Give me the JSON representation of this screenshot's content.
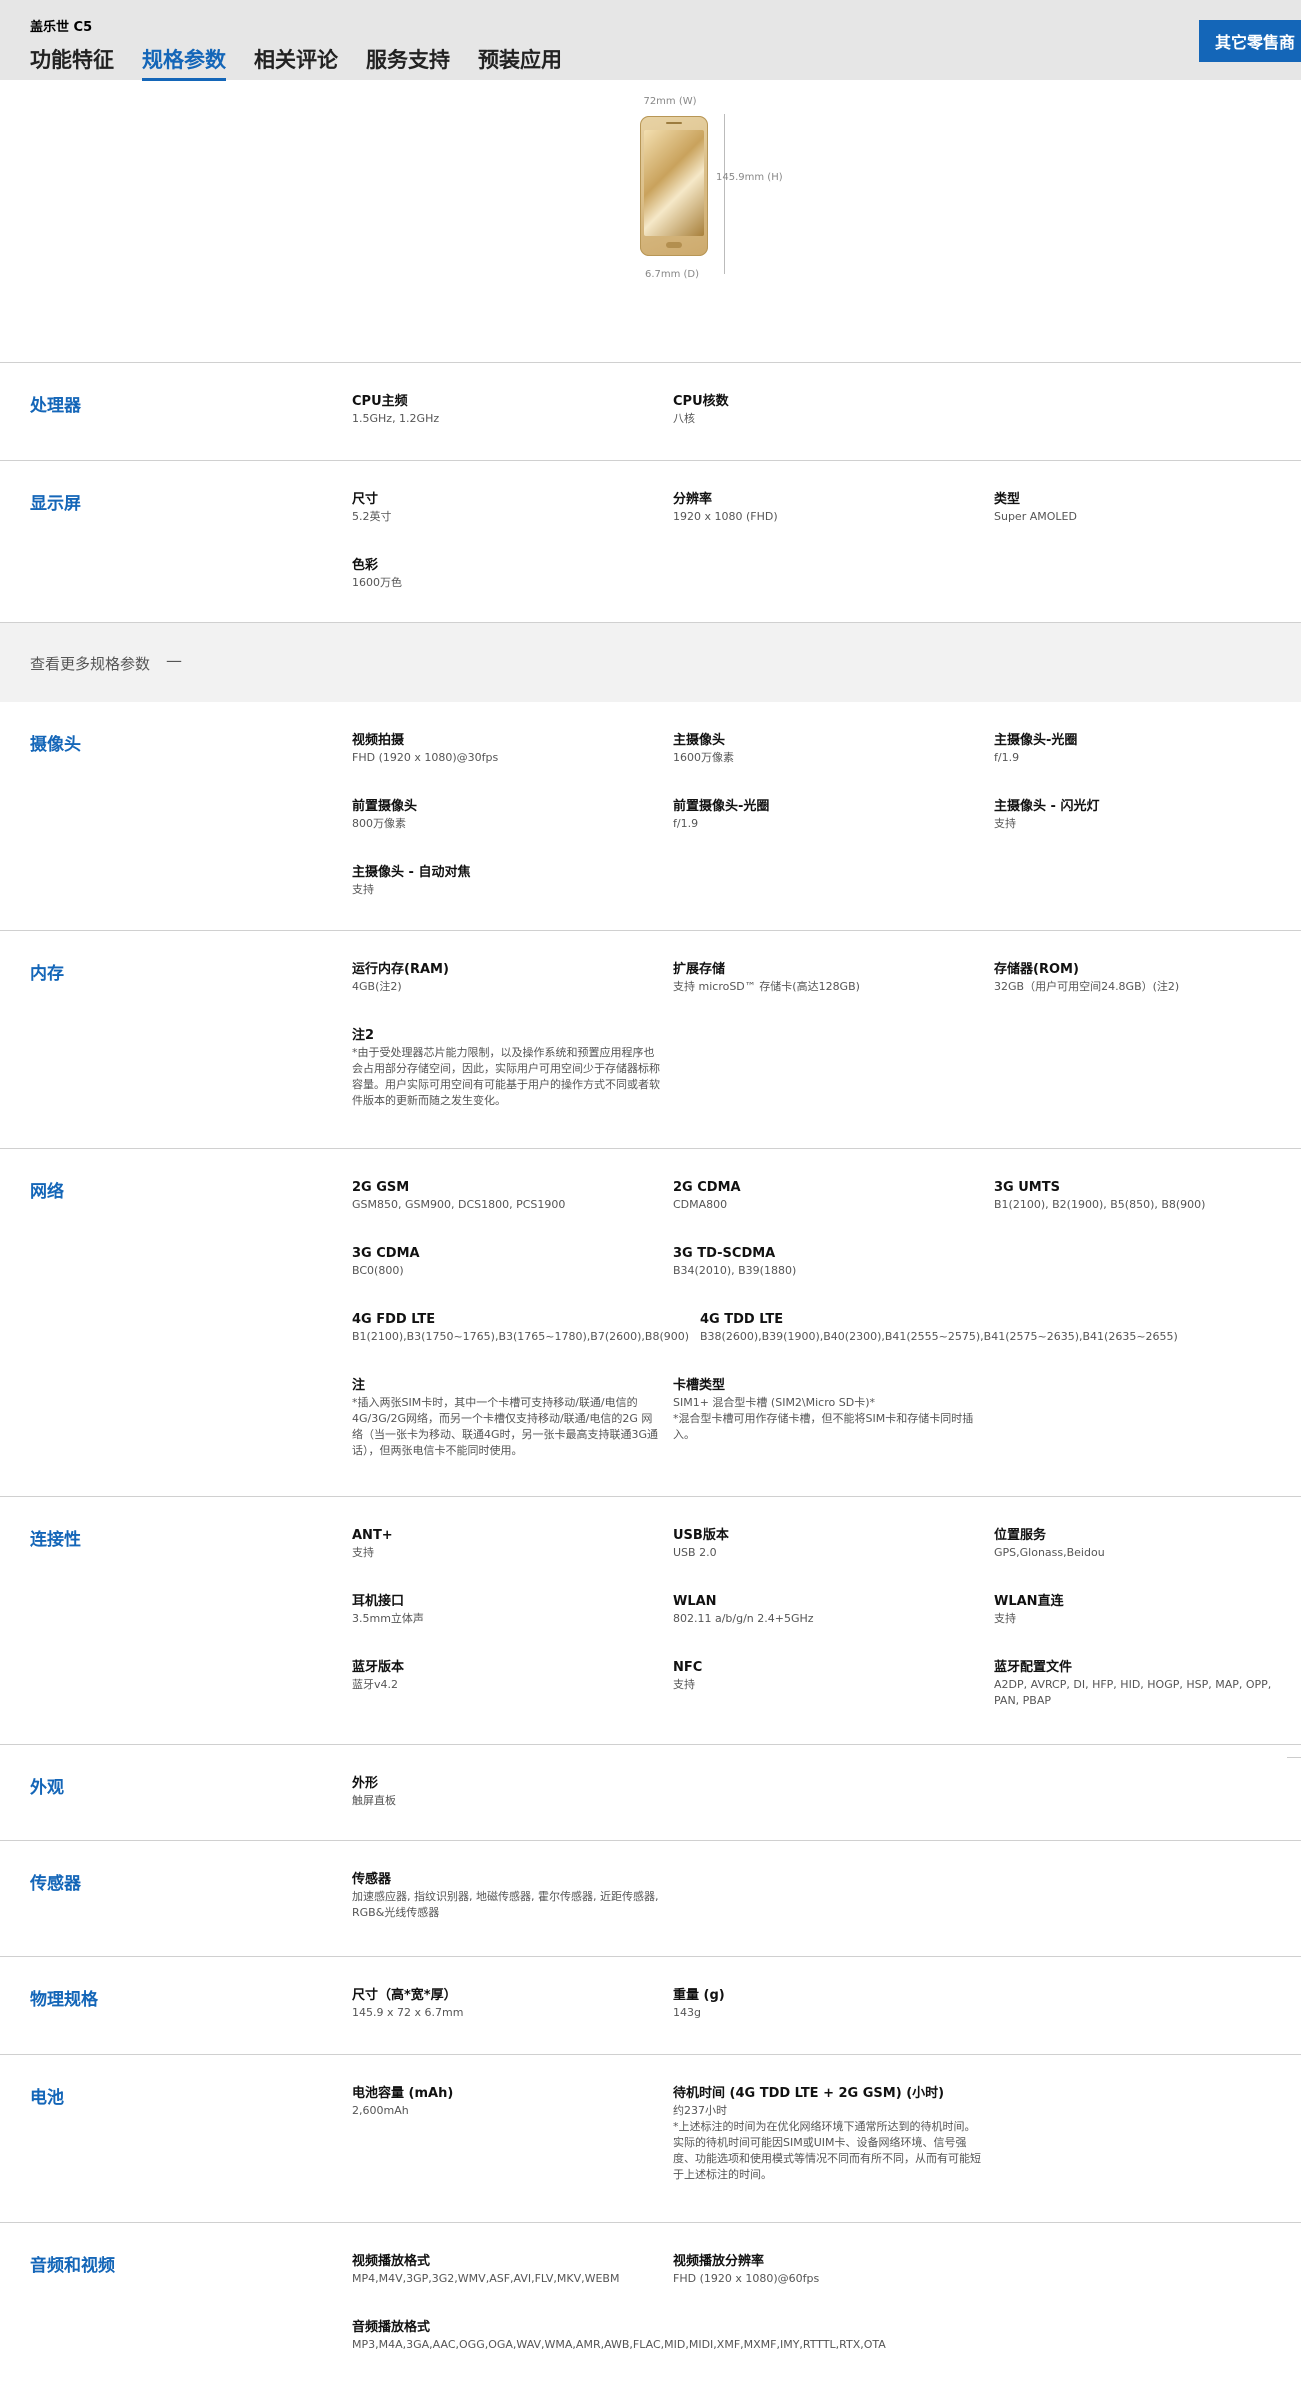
{
  "header": {
    "product_name": "盖乐世 C5",
    "tabs": [
      "功能特征",
      "规格参数",
      "相关评论",
      "服务支持",
      "预装应用"
    ],
    "active_tab": 1,
    "retail_button": "其它零售商"
  },
  "diagram": {
    "width": "72mm (W)",
    "height": "145.9mm (H)",
    "depth": "6.7mm (D)"
  },
  "more_specs": "查看更多规格参数",
  "more_specs_icon": "—",
  "sections": [
    {
      "title": "处理器",
      "items": [
        {
          "label": "CPU主频",
          "value": "1.5GHz, 1.2GHz"
        },
        {
          "label": "CPU核数",
          "value": "八核"
        }
      ]
    },
    {
      "title": "显示屏",
      "items": [
        {
          "label": "尺寸",
          "value": "5.2英寸"
        },
        {
          "label": "分辨率",
          "value": "1920 x 1080 (FHD)"
        },
        {
          "label": "类型",
          "value": "Super AMOLED"
        },
        {
          "label": "色彩",
          "value": "1600万色"
        }
      ]
    },
    {
      "title": "摄像头",
      "items": [
        {
          "label": "视频拍摄",
          "value": "FHD (1920 x 1080)@30fps"
        },
        {
          "label": "主摄像头",
          "value": "1600万像素"
        },
        {
          "label": "主摄像头-光圈",
          "value": "f/1.9"
        },
        {
          "label": "前置摄像头",
          "value": "800万像素"
        },
        {
          "label": "前置摄像头-光圈",
          "value": "f/1.9"
        },
        {
          "label": "主摄像头 - 闪光灯",
          "value": "支持"
        },
        {
          "label": "主摄像头 - 自动对焦",
          "value": "支持"
        }
      ]
    },
    {
      "title": "内存",
      "items": [
        {
          "label": "运行内存(RAM)",
          "value": "4GB(注2)"
        },
        {
          "label": "扩展存储",
          "value": "支持 microSD™ 存储卡(高达128GB)"
        },
        {
          "label": "存储器(ROM)",
          "value": "32GB（用户可用空间24.8GB）(注2)"
        },
        {
          "label": "注2",
          "value": "*由于受处理器芯片能力限制，以及操作系统和预置应用程序也会占用部分存储空间，因此，实际用户可用空间少于存储器标称容量。用户实际可用空间有可能基于用户的操作方式不同或者软件版本的更新而随之发生变化。"
        }
      ]
    },
    {
      "title": "网络",
      "items": [
        {
          "label": "2G GSM",
          "value": "GSM850, GSM900, DCS1800, PCS1900"
        },
        {
          "label": "2G CDMA",
          "value": "CDMA800"
        },
        {
          "label": "3G UMTS",
          "value": "B1(2100), B2(1900), B5(850), B8(900)"
        },
        {
          "label": "3G CDMA",
          "value": "BC0(800)"
        },
        {
          "label": "3G TD-SCDMA",
          "value": "B34(2010), B39(1880)"
        },
        {
          "label": "4G FDD LTE",
          "value": "B1(2100),B3(1750~1765),B3(1765~1780),B7(2600),B8(900)"
        },
        {
          "label": "4G TDD LTE",
          "value": "B38(2600),B39(1900),B40(2300),B41(2555~2575),B41(2575~2635),B41(2635~2655)"
        },
        {
          "label": "注",
          "value": "*插入两张SIM卡时，其中一个卡槽可支持移动/联通/电信的4G/3G/2G网络，而另一个卡槽仅支持移动/联通/电信的2G 网络（当一张卡为移动、联通4G时，另一张卡最高支持联通3G通话），但两张电信卡不能同时使用。"
        },
        {
          "label": "卡槽类型",
          "value": "SIM1+ 混合型卡槽 (SIM2\\Micro SD卡)*\n*混合型卡槽可用作存储卡槽，但不能将SIM卡和存储卡同时插入。"
        }
      ]
    },
    {
      "title": "连接性",
      "items": [
        {
          "label": "ANT+",
          "value": "支持"
        },
        {
          "label": "USB版本",
          "value": "USB 2.0"
        },
        {
          "label": "位置服务",
          "value": "GPS,Glonass,Beidou"
        },
        {
          "label": "耳机接口",
          "value": "3.5mm立体声"
        },
        {
          "label": "WLAN",
          "value": "802.11 a/b/g/n 2.4+5GHz"
        },
        {
          "label": "WLAN直连",
          "value": "支持"
        },
        {
          "label": "蓝牙版本",
          "value": "蓝牙v4.2"
        },
        {
          "label": "NFC",
          "value": "支持"
        },
        {
          "label": "蓝牙配置文件",
          "value": "A2DP, AVRCP, DI, HFP, HID, HOGP, HSP, MAP, OPP, PAN, PBAP"
        }
      ]
    },
    {
      "title": "外观",
      "items": [
        {
          "label": "外形",
          "value": "触屏直板"
        }
      ]
    },
    {
      "title": "传感器",
      "items": [
        {
          "label": "传感器",
          "value": "加速感应器, 指纹识别器, 地磁传感器, 霍尔传感器, 近距传感器, RGB&光线传感器"
        }
      ]
    },
    {
      "title": "物理规格",
      "items": [
        {
          "label": "尺寸（高*宽*厚）",
          "value": "145.9 x 72 x 6.7mm"
        },
        {
          "label": "重量 (g)",
          "value": "143g"
        }
      ]
    },
    {
      "title": "电池",
      "items": [
        {
          "label": "电池容量 (mAh)",
          "value": "2,600mAh"
        },
        {
          "label": "待机时间 (4G TDD LTE + 2G GSM) (小时)",
          "value": "约237小时\n*上述标注的时间为在优化网络环境下通常所达到的待机时间。实际的待机时间可能因SIM或UIM卡、设备网络环境、信号强度、功能选项和使用模式等情况不同而有所不同，从而有可能短于上述标注的时间。"
        }
      ]
    },
    {
      "title": "音频和视频",
      "items": [
        {
          "label": "视频播放格式",
          "value": "MP4,M4V,3GP,3G2,WMV,ASF,AVI,FLV,MKV,WEBM"
        },
        {
          "label": "视频播放分辨率",
          "value": "FHD (1920 x 1080)@60fps"
        },
        {
          "label": "音频播放格式",
          "value": "MP3,M4A,3GA,AAC,OGG,OGA,WAV,WMA,AMR,AWB,FLAC,MID,MIDI,XMF,MXMF,IMY,RTTTL,RTX,OTA"
        }
      ]
    }
  ]
}
